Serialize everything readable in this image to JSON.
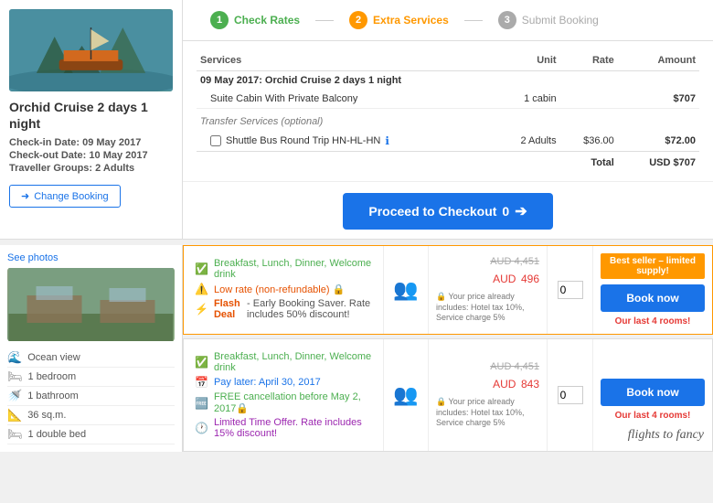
{
  "steps": [
    {
      "num": "1",
      "label": "Check Rates",
      "state": "green"
    },
    {
      "num": "2",
      "label": "Extra Services",
      "state": "orange"
    },
    {
      "num": "3",
      "label": "Submit Booking",
      "state": "gray"
    }
  ],
  "left_panel": {
    "title": "Orchid Cruise 2 days 1 night",
    "checkin_label": "Check-in Date:",
    "checkin_value": "09 May 2017",
    "checkout_label": "Check-out Date:",
    "checkout_value": "10 May 2017",
    "traveller_label": "Traveller Groups:",
    "traveller_value": "2 Adults",
    "change_booking": "Change Booking"
  },
  "table": {
    "headers": {
      "services": "Services",
      "unit": "Unit",
      "rate": "Rate",
      "amount": "Amount"
    },
    "section_title": "09 May 2017: Orchid Cruise 2 days 1 night",
    "main_service": "Suite Cabin With Private Balcony",
    "main_unit": "1 cabin",
    "main_amount": "$707",
    "transfer_section": "Transfer Services (optional)",
    "transfer_service": "Shuttle Bus Round Trip HN-HL-HN",
    "transfer_unit": "2 Adults",
    "transfer_rate": "$36.00",
    "transfer_amount": "$72.00",
    "total_label": "Total",
    "total_amount": "USD $707"
  },
  "checkout": {
    "label": "Proceed to Checkout",
    "count": "0"
  },
  "bottom_left": {
    "see_photos": "See photos",
    "amenities": [
      {
        "icon": "🌊",
        "label": "Ocean view"
      },
      {
        "icon": "🛏",
        "label": "1 bedroom"
      },
      {
        "icon": "🚿",
        "label": "1 bathroom"
      },
      {
        "icon": "📐",
        "label": "36 sq.m."
      },
      {
        "icon": "🛏",
        "label": "1 double bed"
      }
    ]
  },
  "rooms": [
    {
      "featured": true,
      "features": [
        {
          "type": "green-check",
          "text": "Breakfast, Lunch, Dinner, Welcome drink"
        },
        {
          "type": "orange-warning",
          "text": "Low rate (non-refundable) 🔒"
        },
        {
          "type": "flash",
          "bold": "Flash Deal",
          "text": " - Early Booking Saver. Rate includes 50% discount!"
        }
      ],
      "old_price": "AUD 4,451",
      "currency": "AUD",
      "new_price": "496",
      "price_note": "🔒 Your price already includes: Hotel tax 10%, Service charge 5%",
      "qty": "0",
      "badges": {
        "best_seller": "Best seller – limited supply!"
      },
      "book_label": "Book now",
      "last_rooms": "Our last 4 rooms!"
    },
    {
      "featured": false,
      "features": [
        {
          "type": "green-check",
          "text": "Breakfast, Lunch, Dinner, Welcome drink"
        },
        {
          "type": "blue-calendar",
          "text": "Pay later: April 30, 2017"
        },
        {
          "type": "green-free",
          "text": "FREE cancellation before May 2, 2017🔒"
        },
        {
          "type": "purple-time",
          "text": "Limited Time Offer. Rate includes 15% discount!"
        }
      ],
      "old_price": "AUD 4,451",
      "currency": "AUD",
      "new_price": "843",
      "price_note": "🔒 Your price already includes: Hotel tax 10%, Service charge 5%",
      "qty": "0",
      "badges": {},
      "book_label": "Book now",
      "last_rooms": "Our last 4 rooms!"
    }
  ],
  "watermark": "flights to fancy"
}
